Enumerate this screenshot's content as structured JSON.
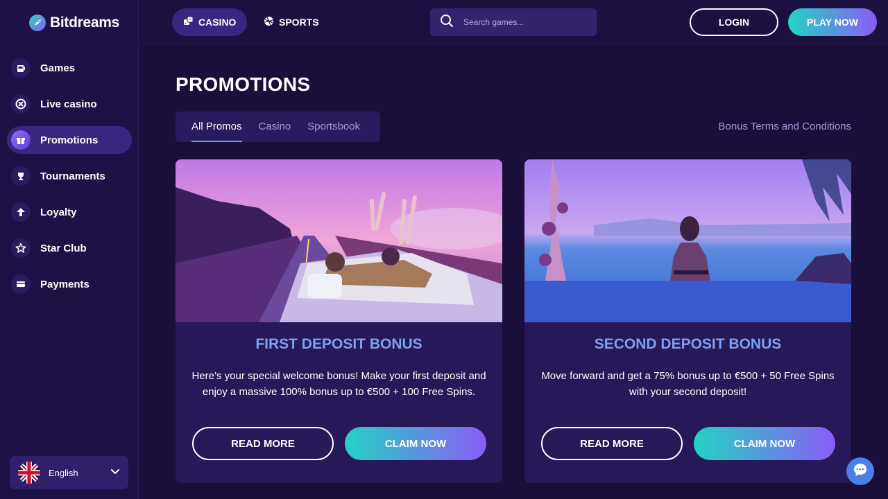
{
  "brand": {
    "name": "Bitdreams",
    "icon": "rocket-icon"
  },
  "sidebar": {
    "items": [
      {
        "label": "Games",
        "icon": "slot-machine-icon"
      },
      {
        "label": "Live casino",
        "icon": "poker-chip-icon"
      },
      {
        "label": "Promotions",
        "icon": "gift-icon",
        "active": true
      },
      {
        "label": "Tournaments",
        "icon": "trophy-icon"
      },
      {
        "label": "Loyalty",
        "icon": "arrow-up-icon"
      },
      {
        "label": "Star Club",
        "icon": "star-icon"
      },
      {
        "label": "Payments",
        "icon": "card-icon"
      }
    ],
    "language": {
      "label": "English",
      "icon": "uk-flag-icon"
    }
  },
  "topbar": {
    "tabs": [
      {
        "label": "CASINO",
        "icon": "dice-icon",
        "active": true
      },
      {
        "label": "SPORTS",
        "icon": "ball-icon"
      }
    ],
    "search": {
      "placeholder": "Search games..."
    },
    "login_label": "LOGIN",
    "play_label": "PLAY NOW"
  },
  "main": {
    "title": "PROMOTIONS",
    "filters": [
      {
        "label": "All Promos",
        "active": true
      },
      {
        "label": "Casino"
      },
      {
        "label": "Sportsbook"
      }
    ],
    "terms_link": "Bonus Terms and Conditions",
    "promos": [
      {
        "title": "FIRST DEPOSIT BONUS",
        "description": "Here’s your special welcome bonus! Make your first deposit and enjoy a massive 100% bonus up to €500 + 100 Free Spins.",
        "read_more": "READ MORE",
        "claim": "CLAIM NOW"
      },
      {
        "title": "SECOND DEPOSIT BONUS",
        "description": "Move forward and get a 75% bonus up to €500 + 50 Free Spins with your second deposit!",
        "read_more": "READ MORE",
        "claim": "CLAIM NOW"
      }
    ]
  },
  "colors": {
    "background": "#1a0f3a",
    "sidebar": "#1e1146",
    "accent_gradient_start": "#22d3c3",
    "accent_gradient_end": "#8b5cf6",
    "promo_title": "#7fa0f5"
  }
}
